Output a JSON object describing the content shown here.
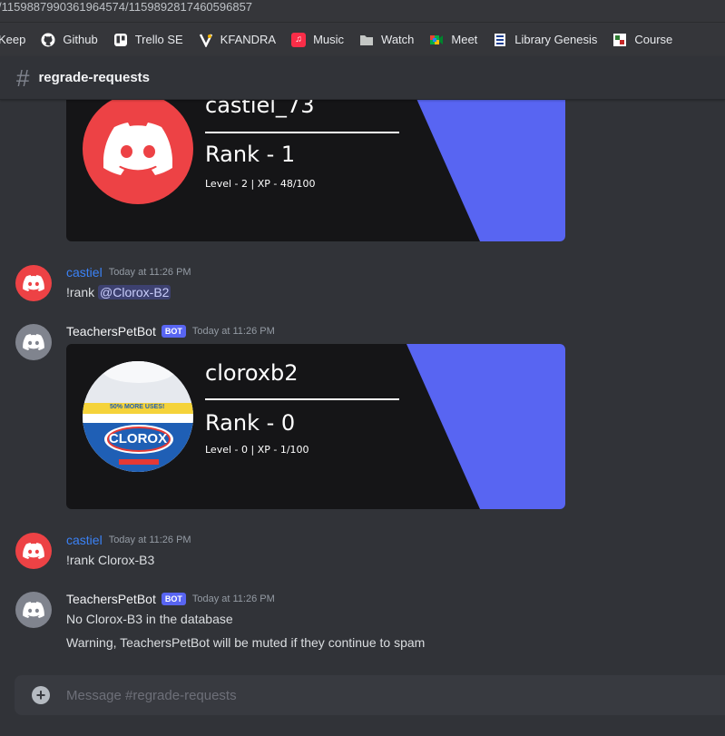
{
  "browser": {
    "url": "/1159887990361964574/1159892817460596857",
    "bookmarks": [
      {
        "label": "Keep",
        "icon": "keep-icon",
        "color": "#fbbc04"
      },
      {
        "label": "Github",
        "icon": "github-icon",
        "color": "#ffffff"
      },
      {
        "label": "Trello SE",
        "icon": "trello-icon",
        "color": "#ffffff"
      },
      {
        "label": "KFANDRA",
        "icon": "kfandra-icon",
        "color": "#ffffff"
      },
      {
        "label": "Music",
        "icon": "music-icon",
        "color": "#fa2d48"
      },
      {
        "label": "Watch",
        "icon": "folder-icon",
        "color": "#c4c7c5"
      },
      {
        "label": "Meet",
        "icon": "meet-icon",
        "color": "#00ac47"
      },
      {
        "label": "Library Genesis",
        "icon": "library-icon",
        "color": "#ffffff"
      },
      {
        "label": "Course",
        "icon": "course-icon",
        "color": "#ffffff"
      }
    ]
  },
  "channel": {
    "hash": "#",
    "name": "regrade-requests"
  },
  "messages": [
    {
      "type": "card",
      "card": {
        "name": "castiel_73",
        "rank": "Rank - 1",
        "level": "Level - 2 | XP - 48/100",
        "avatar": "discord-logo"
      }
    },
    {
      "type": "user",
      "username": "castiel",
      "timestamp": "Today at 11:26 PM",
      "text_prefix": "!rank ",
      "mention": "@Clorox-B2"
    },
    {
      "type": "bot",
      "username": "TeachersPetBot",
      "bot_tag": "BOT",
      "timestamp": "Today at 11:26 PM",
      "card": {
        "name": "cloroxb2",
        "rank": "Rank - 0",
        "level": "Level - 0 | XP - 1/100",
        "avatar": "clorox-bottle",
        "avatar_text": "CLOROX",
        "avatar_banner": "50% MORE USES!"
      }
    },
    {
      "type": "user",
      "username": "castiel",
      "timestamp": "Today at 11:26 PM",
      "text": "!rank Clorox-B3"
    },
    {
      "type": "bot",
      "username": "TeachersPetBot",
      "bot_tag": "BOT",
      "timestamp": "Today at 11:26 PM",
      "lines": [
        "No Clorox-B3 in the database",
        "Warning, TeachersPetBot will be muted if they continue to spam"
      ]
    }
  ],
  "composer": {
    "placeholder": "Message #regrade-requests"
  },
  "colors": {
    "background": "#313338",
    "blurple": "#5865f2",
    "card_stripe": "#5865f2",
    "red_avatar": "#ed4245",
    "grey_avatar": "#80848e",
    "user_name": "#3b82f6"
  }
}
